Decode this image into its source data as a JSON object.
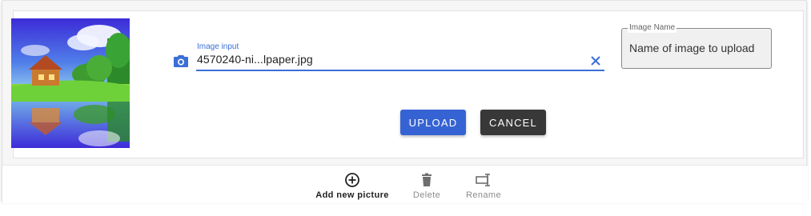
{
  "image_input": {
    "label": "Image input",
    "value": "4570240-ni...lpaper.jpg",
    "camera_icon": "camera-icon",
    "clear_icon": "close-icon",
    "accent_color": "#3b6fd8"
  },
  "image_name": {
    "legend": "Image Name",
    "placeholder": "Name of image to upload"
  },
  "actions": {
    "upload_label": "UPLOAD",
    "cancel_label": "CANCEL",
    "upload_color": "#3663d4",
    "cancel_color": "#383838"
  },
  "toolbar": {
    "add_label": "Add new picture",
    "add_icon": "plus-circle-icon",
    "delete_label": "Delete",
    "delete_icon": "trash-icon",
    "rename_label": "Rename",
    "rename_icon": "rename-icon"
  }
}
